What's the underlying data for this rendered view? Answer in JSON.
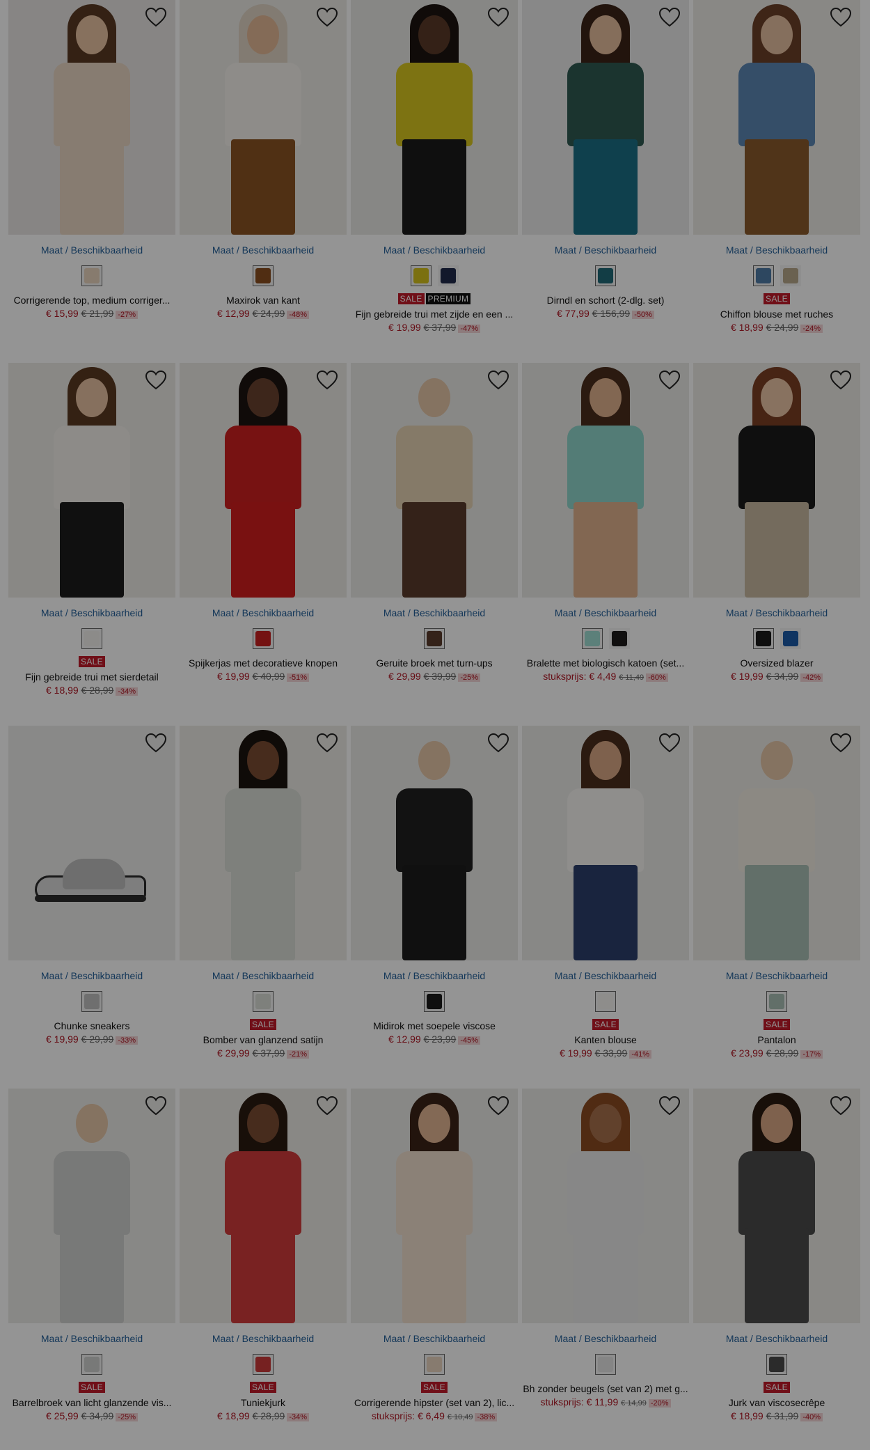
{
  "colors": {
    "link": "#24609a",
    "sale": "#c21a2a",
    "price": "#b01825",
    "overlay": "rgba(0,0,0,0.42)"
  },
  "products": [
    {
      "availability": "Maat / Beschikbaarheid",
      "swatches": [
        "#e8d4bd"
      ],
      "badges": [],
      "title": "Corrigerende top, medium corriger...",
      "price": "€ 15,99",
      "old_price": "€ 21,99",
      "discount": "-27%",
      "img": {
        "bg": "#e9e6e3",
        "hair": "#5a3a24",
        "skin": "#e8c3a3",
        "top": "#e9d6c3",
        "bottom": "#e9d6c3"
      }
    },
    {
      "availability": "Maat / Beschikbaarheid",
      "swatches": [
        "#8a4f1f"
      ],
      "badges": [],
      "title": "Maxirok van kant",
      "price": "€ 12,99",
      "old_price": "€ 24,99",
      "discount": "-48%",
      "img": {
        "bg": "#eceae6",
        "hair": "#e0d4c4",
        "skin": "#e3b996",
        "top": "#f4f1ec",
        "bottom": "#8a5323"
      }
    },
    {
      "availability": "Maat / Beschikbaarheid",
      "swatches": [
        "#d4c21c",
        "#1f2a4b"
      ],
      "badges": [
        "SALE",
        "PREMIUM"
      ],
      "title": "Fijn gebreide trui met zijde en een ...",
      "price": "€ 19,99",
      "old_price": "€ 37,99",
      "discount": "-47%",
      "img": {
        "bg": "#e9e8e5",
        "hair": "#1c1410",
        "skin": "#5b3a28",
        "top": "#d8c61f",
        "bottom": "#1b1b1b"
      }
    },
    {
      "availability": "Maat / Beschikbaarheid",
      "swatches": [
        "#1f6a78"
      ],
      "badges": [],
      "title": "Dirndl en schort (2-dlg. set)",
      "price": "€ 77,99",
      "old_price": "€ 156,99",
      "discount": "-50%",
      "img": {
        "bg": "#ebebea",
        "hair": "#3b2417",
        "skin": "#e6bd9e",
        "top": "#2f5a52",
        "bottom": "#1b6f86"
      }
    },
    {
      "availability": "Maat / Beschikbaarheid",
      "swatches": [
        "#4f7aa5",
        "#b7a78a"
      ],
      "badges": [
        "SALE"
      ],
      "title": "Chiffon blouse met ruches",
      "price": "€ 18,99",
      "old_price": "€ 24,99",
      "discount": "-24%",
      "img": {
        "bg": "#eceae6",
        "hair": "#6b4029",
        "skin": "#e6c0a0",
        "top": "#5c87b4",
        "bottom": "#8a5a2c"
      }
    },
    {
      "availability": "Maat / Beschikbaarheid",
      "swatches": [
        "#f2f0ec"
      ],
      "badges": [
        "SALE"
      ],
      "title": "Fijn gebreide trui met sierdetail",
      "price": "€ 18,99",
      "old_price": "€ 28,99",
      "discount": "-34%",
      "img": {
        "bg": "#eceae6",
        "hair": "#5b3a22",
        "skin": "#e7c2a2",
        "top": "#f3f0ea",
        "bottom": "#1d1c1c"
      }
    },
    {
      "availability": "Maat / Beschikbaarheid",
      "swatches": [
        "#c8201f"
      ],
      "badges": [],
      "title": "Spijkerjas met decoratieve knopen",
      "price": "€ 19,99",
      "old_price": "€ 40,99",
      "discount": "-51%",
      "img": {
        "bg": "#eceae6",
        "hair": "#1c1410",
        "skin": "#6a4330",
        "top": "#cd1f1f",
        "bottom": "#d01e1e"
      }
    },
    {
      "availability": "Maat / Beschikbaarheid",
      "swatches": [
        "#5b3b2c"
      ],
      "badges": [],
      "title": "Geruite broek met turn-ups",
      "price": "€ 29,99",
      "old_price": "€ 39,99",
      "discount": "-25%",
      "img": {
        "bg": "#ebeae7",
        "hair": "#ebeae7",
        "skin": "#e6c6a8",
        "top": "#e6d3b4",
        "bottom": "#5b3b2c"
      }
    },
    {
      "availability": "Maat / Beschikbaarheid",
      "swatches": [
        "#9fdcd2",
        "#1c1a1a"
      ],
      "badges": [],
      "title": "Bralette met biologisch katoen (set...",
      "unit_label": "stuksprijs:",
      "price": "€ 4,49",
      "old_price": "€ 11,49",
      "discount": "-60%",
      "img": {
        "bg": "#ebeae7",
        "hair": "#4a2e1c",
        "skin": "#e0b18e",
        "top": "#8fd6cc",
        "bottom": "#e0b18e"
      }
    },
    {
      "availability": "Maat / Beschikbaarheid",
      "swatches": [
        "#1a1a1a",
        "#1b5aa8"
      ],
      "badges": [],
      "title": "Oversized blazer",
      "price": "€ 19,99",
      "old_price": "€ 34,99",
      "discount": "-42%",
      "img": {
        "bg": "#eceae6",
        "hair": "#7a3f24",
        "skin": "#eac5a6",
        "top": "#1b1b1b",
        "bottom": "#c9b9a0"
      }
    },
    {
      "availability": "Maat / Beschikbaarheid",
      "swatches": [
        "#bfbfbf"
      ],
      "badges": [],
      "title": "Chunke sneakers",
      "price": "€ 19,99",
      "old_price": "€ 29,99",
      "discount": "-33%",
      "img": {
        "bg": "#ededeb",
        "hair": "#ededeb",
        "skin": "#ededeb",
        "top": "#ededeb",
        "bottom": "#ededeb",
        "shoe": true
      }
    },
    {
      "availability": "Maat / Beschikbaarheid",
      "swatches": [
        "#d9ddd6"
      ],
      "badges": [
        "SALE"
      ],
      "title": "Bomber van glanzend satijn",
      "price": "€ 29,99",
      "old_price": "€ 37,99",
      "discount": "-21%",
      "img": {
        "bg": "#eceae6",
        "hair": "#1b130e",
        "skin": "#7a4c33",
        "top": "#d9ddd6",
        "bottom": "#d9ddd6"
      }
    },
    {
      "availability": "Maat / Beschikbaarheid",
      "swatches": [
        "#1b1b1b"
      ],
      "badges": [],
      "title": "Midirok met soepele viscose",
      "price": "€ 12,99",
      "old_price": "€ 23,99",
      "discount": "-45%",
      "img": {
        "bg": "#ebeae7",
        "hair": "#ebeae7",
        "skin": "#e6c6a8",
        "top": "#202020",
        "bottom": "#1d1d1d"
      }
    },
    {
      "availability": "Maat / Beschikbaarheid",
      "swatches": [
        "#f5f3f0"
      ],
      "badges": [
        "SALE"
      ],
      "title": "Kanten blouse",
      "price": "€ 19,99",
      "old_price": "€ 33,99",
      "discount": "-41%",
      "img": {
        "bg": "#ebeae7",
        "hair": "#4a2e1c",
        "skin": "#d9a886",
        "top": "#f6f4f1",
        "bottom": "#2b3f6b"
      }
    },
    {
      "availability": "Maat / Beschikbaarheid",
      "swatches": [
        "#a9bfb6"
      ],
      "badges": [
        "SALE"
      ],
      "title": "Pantalon",
      "price": "€ 23,99",
      "old_price": "€ 28,99",
      "discount": "-17%",
      "img": {
        "bg": "#eceae6",
        "hair": "#eceae6",
        "skin": "#e6c6a8",
        "top": "#f1ece2",
        "bottom": "#a9bfb6"
      }
    },
    {
      "availability": "Maat / Beschikbaarheid",
      "swatches": [
        "#cfd0cf"
      ],
      "badges": [
        "SALE"
      ],
      "title": "Barrelbroek van licht glanzende vis...",
      "price": "€ 25,99",
      "old_price": "€ 34,99",
      "discount": "-25%",
      "img": {
        "bg": "#ebeae7",
        "hair": "#ebeae7",
        "skin": "#e6c6a8",
        "top": "#cfd0cf",
        "bottom": "#cfd0cf"
      }
    },
    {
      "availability": "Maat / Beschikbaarheid",
      "swatches": [
        "#cc3a3a"
      ],
      "badges": [
        "SALE"
      ],
      "title": "Tuniekjurk",
      "price": "€ 18,99",
      "old_price": "€ 28,99",
      "discount": "-34%",
      "img": {
        "bg": "#eceae6",
        "hair": "#2a1a10",
        "skin": "#7a4c33",
        "top": "#d13b3b",
        "bottom": "#d13b3b"
      }
    },
    {
      "availability": "Maat / Beschikbaarheid",
      "swatches": [
        "#e9d5c0"
      ],
      "badges": [
        "SALE"
      ],
      "title": "Corrigerende hipster (set van 2), lic...",
      "unit_label": "stuksprijs:",
      "price": "€ 6,49",
      "old_price": "€ 10,49",
      "discount": "-38%",
      "img": {
        "bg": "#ebeae7",
        "hair": "#3b2417",
        "skin": "#e2b593",
        "top": "#efdfcd",
        "bottom": "#efdfcd"
      }
    },
    {
      "availability": "Maat / Beschikbaarheid",
      "swatches": [
        "#e6e6e6"
      ],
      "badges": [],
      "title": "Bh zonder beugels (set van 2) met g...",
      "unit_label": "stuksprijs:",
      "price": "€ 11,99",
      "old_price": "€ 14,99",
      "discount": "-20%",
      "img": {
        "bg": "#ebeae7",
        "hair": "#8a4a22",
        "skin": "#a8704d",
        "top": "#e8e8e8",
        "bottom": "#e8e8e8"
      }
    },
    {
      "availability": "Maat / Beschikbaarheid",
      "swatches": [
        "#4a4a4a"
      ],
      "badges": [
        "SALE"
      ],
      "title": "Jurk van viscosecrêpe",
      "price": "€ 18,99",
      "old_price": "€ 31,99",
      "discount": "-40%",
      "img": {
        "bg": "#eceae6",
        "hair": "#2a1a10",
        "skin": "#d9a886",
        "top": "#4a4a4a",
        "bottom": "#4a4a4a"
      }
    }
  ]
}
